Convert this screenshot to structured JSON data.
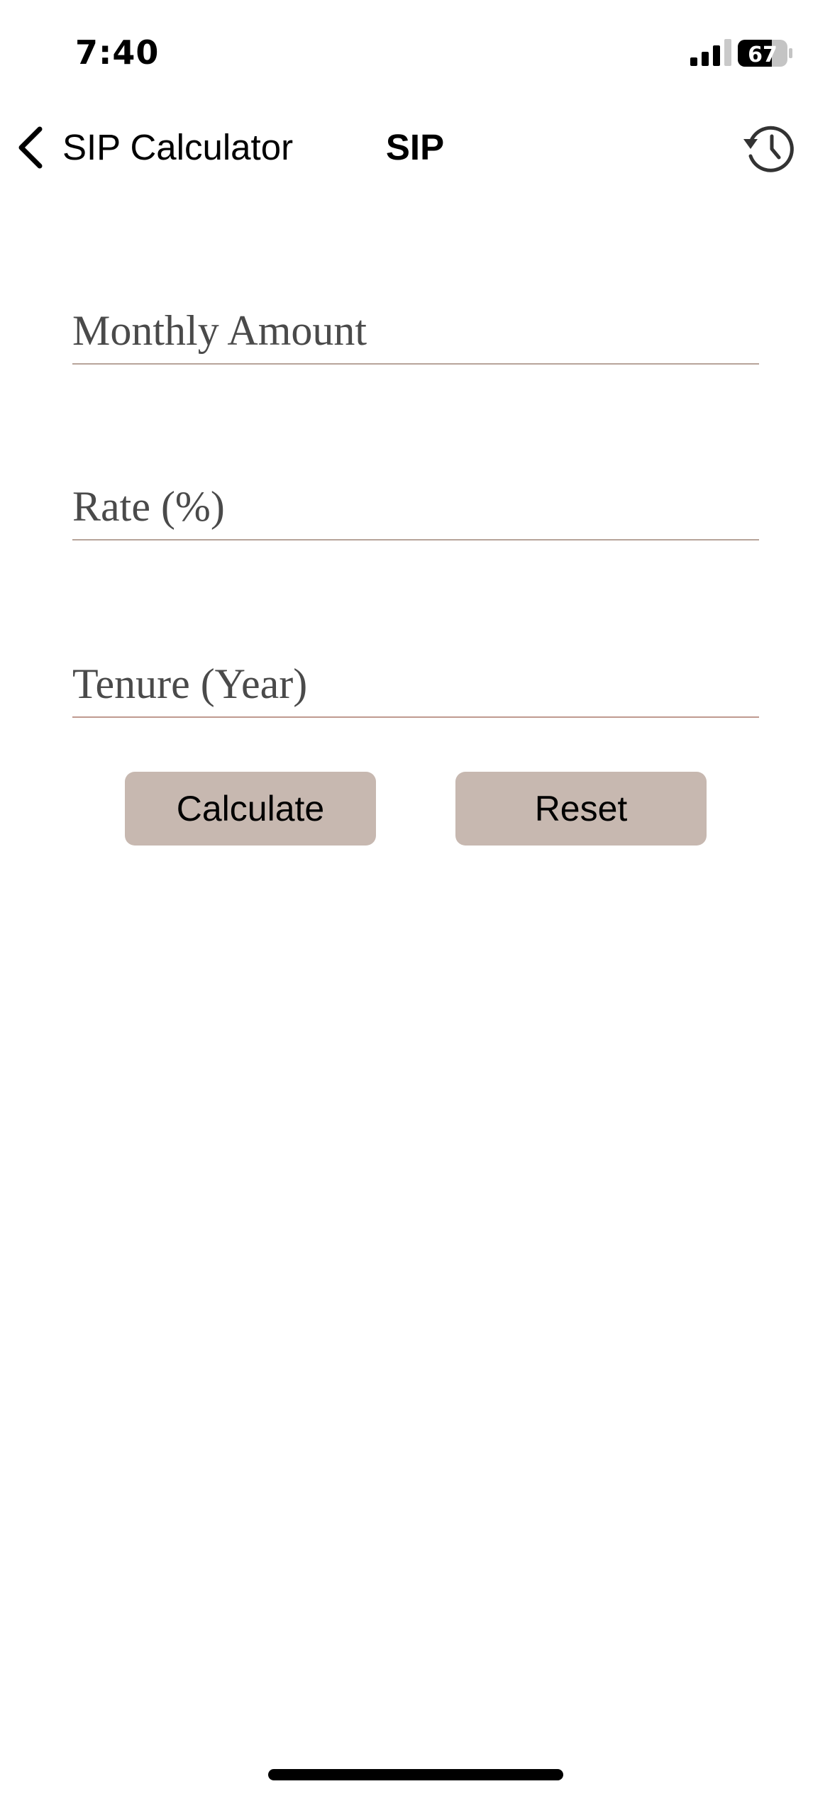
{
  "status_bar": {
    "time": "7:40",
    "battery_level": "67",
    "icons": [
      "signal-icon",
      "battery-icon"
    ]
  },
  "nav": {
    "back_label": "SIP Calculator",
    "title": "SIP",
    "icons": [
      "chevron-left-icon",
      "history-icon"
    ]
  },
  "form": {
    "monthly_amount": {
      "placeholder": "Monthly Amount",
      "value": ""
    },
    "rate": {
      "placeholder": "Rate (%)",
      "value": ""
    },
    "tenure": {
      "placeholder": "Tenure (Year)",
      "value": ""
    }
  },
  "buttons": {
    "calculate_label": "Calculate",
    "reset_label": "Reset"
  },
  "colors": {
    "button_bg": "#c7b8b0",
    "field_underline": "#b7a49a",
    "background": "#ffffff"
  }
}
